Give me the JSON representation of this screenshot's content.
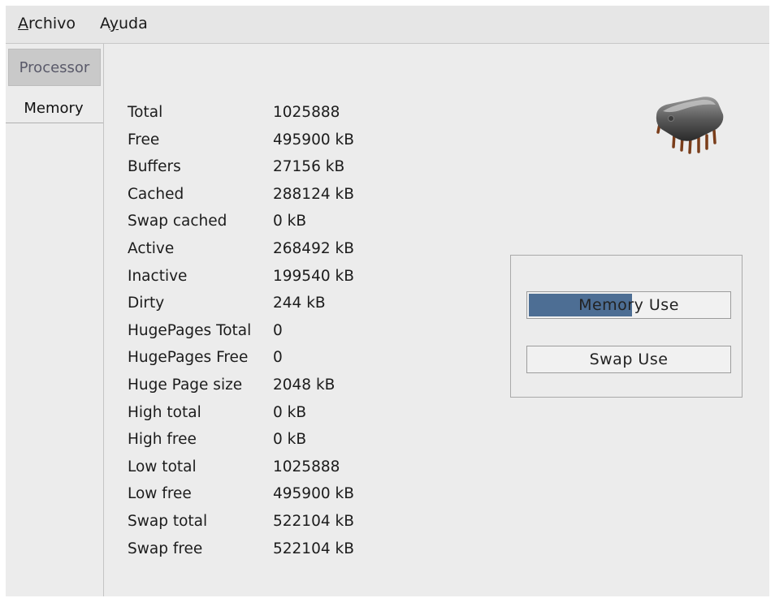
{
  "menubar": {
    "archivo": "Archivo",
    "ayuda_pre": "A",
    "ayuda_ul": "y",
    "ayuda_post": "uda"
  },
  "tabs": {
    "processor": "Processor",
    "memory": "Memory"
  },
  "memory_stats": [
    {
      "label": "Total",
      "value": "1025888"
    },
    {
      "label": "Free",
      "value": "495900 kB"
    },
    {
      "label": "Buffers",
      "value": "27156 kB"
    },
    {
      "label": "Cached",
      "value": "288124 kB"
    },
    {
      "label": "Swap cached",
      "value": "0 kB"
    },
    {
      "label": "Active",
      "value": "268492 kB"
    },
    {
      "label": "Inactive",
      "value": "199540 kB"
    },
    {
      "label": "Dirty",
      "value": "244 kB"
    },
    {
      "label": "HugePages Total",
      "value": "0"
    },
    {
      "label": "HugePages Free",
      "value": "0"
    },
    {
      "label": "Huge Page size",
      "value": "2048 kB"
    },
    {
      "label": "High total",
      "value": "0 kB"
    },
    {
      "label": "High free",
      "value": "0 kB"
    },
    {
      "label": "Low total",
      "value": "1025888"
    },
    {
      "label": "Low free",
      "value": "495900 kB"
    },
    {
      "label": "Swap total",
      "value": "522104 kB"
    },
    {
      "label": "Swap free",
      "value": "522104 kB"
    }
  ],
  "usage": {
    "memory": {
      "label": "Memory Use",
      "fraction": 0.517
    },
    "swap": {
      "label": "Swap Use",
      "fraction": 0
    }
  },
  "icons": {
    "chip": "memory-chip-icon"
  },
  "colors": {
    "bar_fill": "#4d6e94"
  }
}
